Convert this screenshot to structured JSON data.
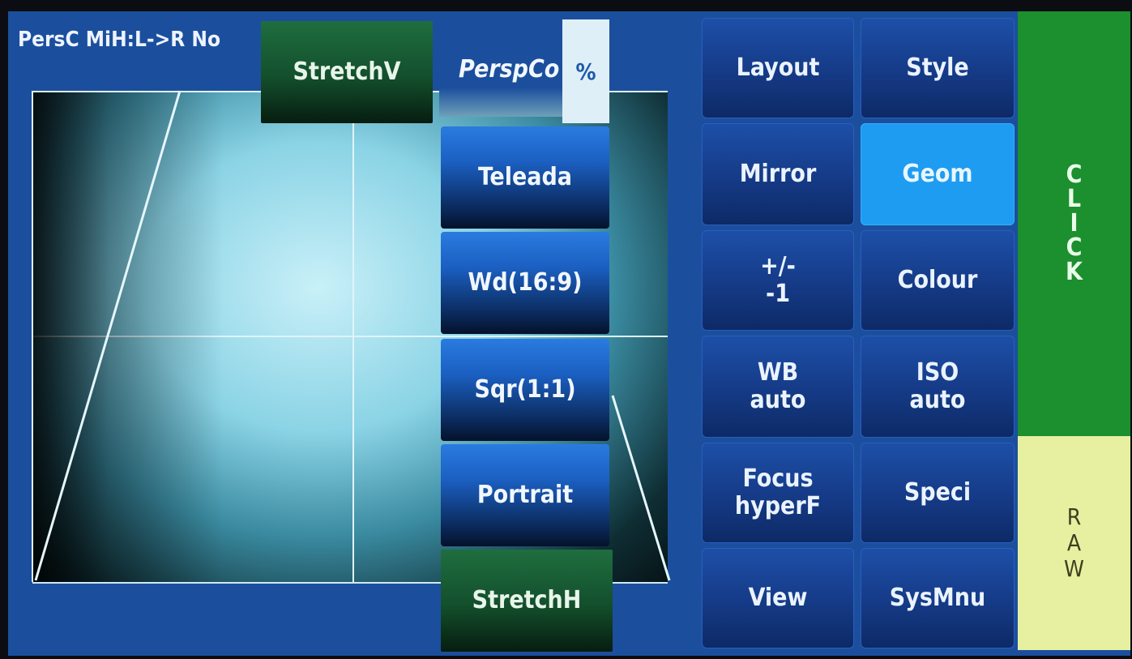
{
  "status_line": "PersC MiH:L->R No",
  "top_buttons": {
    "stretch_v": "StretchV",
    "persp_label": "PerspCo",
    "percent": "%"
  },
  "format_menu": [
    "Teleada",
    "Wd(16:9)",
    "Sqr(1:1)",
    "Portrait"
  ],
  "stretch_h": "StretchH",
  "grid_buttons": {
    "layout": "Layout",
    "style": "Style",
    "mirror": "Mirror",
    "geom": "Geom",
    "plusminus_l1": "+/-",
    "plusminus_l2": "-1",
    "colour": "Colour",
    "wb_l1": "WB",
    "wb_l2": "auto",
    "iso_l1": "ISO",
    "iso_l2": "auto",
    "focus_l1": "Focus",
    "focus_l2": "hyperF",
    "speci": "Speci",
    "view": "View",
    "sysmnu": "SysMnu"
  },
  "click_letters": [
    "C",
    "L",
    "I",
    "C",
    "K"
  ],
  "raw_letters": [
    "R",
    "A",
    "W"
  ],
  "colors": {
    "screen_bg": "#1b4f9d",
    "button_dark": "#153a86",
    "geom_active": "#1e9cf2",
    "click_green": "#1c8f2e",
    "raw_yellow": "#e6f0a0",
    "stretch_green": "#1f6e3f"
  }
}
